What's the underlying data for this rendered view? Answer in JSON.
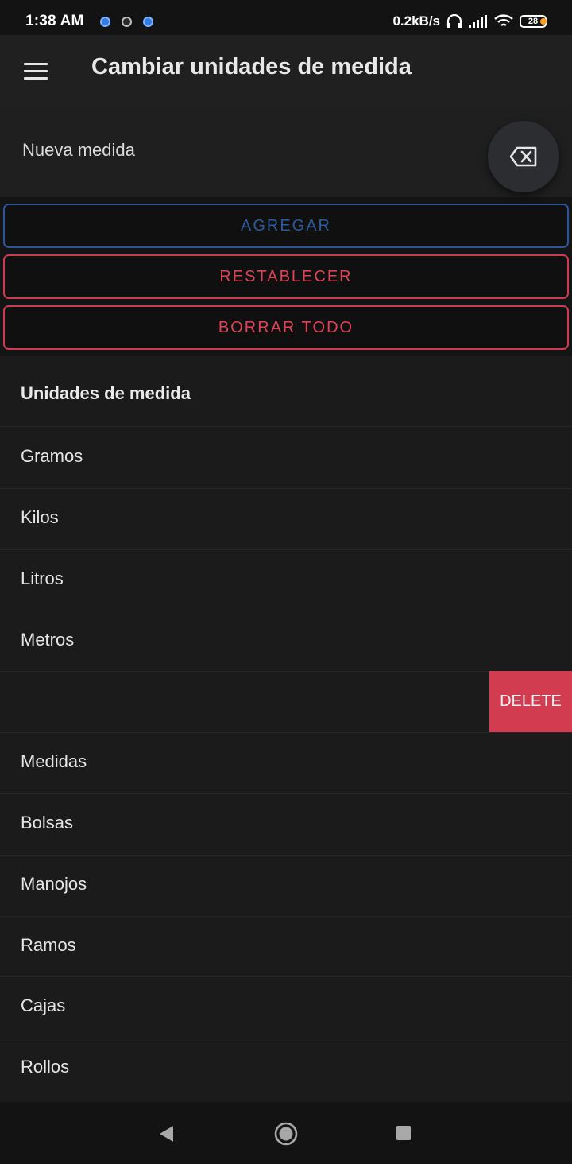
{
  "status_bar": {
    "time": "1:38 AM",
    "speed": "0.2kB/s",
    "battery": "28",
    "icons": [
      "notification-icon",
      "notification-icon",
      "notification-icon",
      "headphones-icon",
      "signal-icon",
      "wifi-icon",
      "battery-icon"
    ]
  },
  "app_bar": {
    "title": "Cambiar unidades de medida",
    "menu_icon": "menu-icon"
  },
  "input": {
    "placeholder": "Nueva medida",
    "value": "",
    "clear_icon": "backspace-icon"
  },
  "buttons": {
    "add": "AGREGAR",
    "reset": "RESTABLECER",
    "clear_all": "BORRAR TODO"
  },
  "colors": {
    "add_accent": "#2f5a9c",
    "danger": "#e04356",
    "delete_bg": "#d23c50"
  },
  "list": {
    "header": "Unidades de medida",
    "items": [
      {
        "label": "Gramos"
      },
      {
        "label": "Kilos"
      },
      {
        "label": "Litros"
      },
      {
        "label": "Metros"
      },
      {
        "label": ""
      },
      {
        "label": "Medidas"
      },
      {
        "label": "Bolsas"
      },
      {
        "label": "Manojos"
      },
      {
        "label": "Ramos"
      },
      {
        "label": "Cajas"
      },
      {
        "label": "Rollos"
      }
    ],
    "delete_label": "DELETE"
  },
  "nav": {
    "icons": [
      "back-icon",
      "home-icon",
      "recents-icon"
    ]
  }
}
